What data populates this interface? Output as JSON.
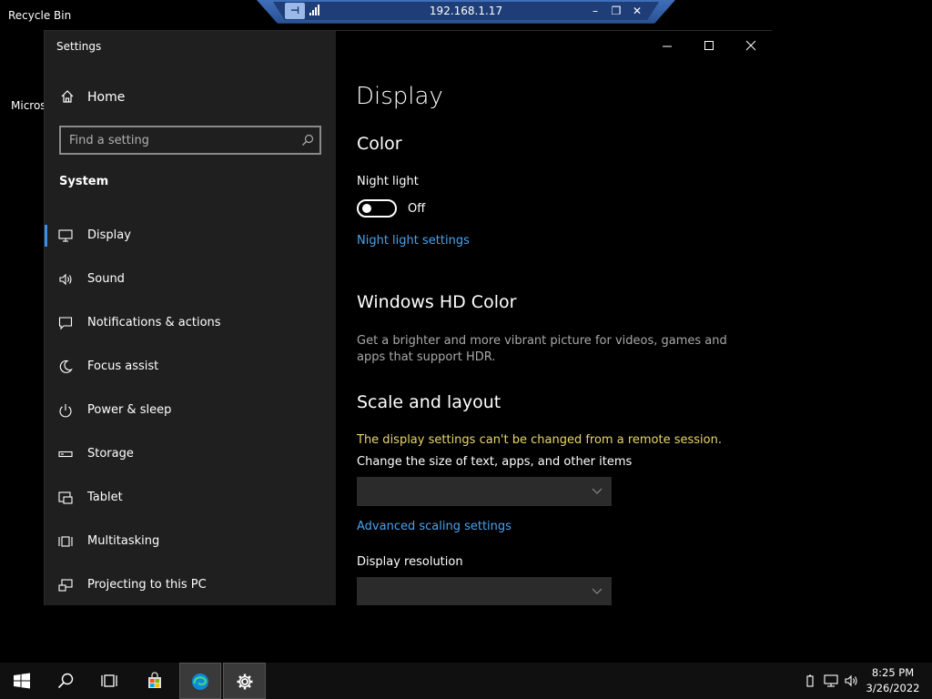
{
  "desktop": {
    "recycle_bin_label": "Recycle Bin",
    "edge_label": "Microsoft Edge"
  },
  "rdp_bar": {
    "host": "192.168.1.17",
    "pin_icon": "pin-icon",
    "signal_icon": "signal-icon"
  },
  "window": {
    "title": "Settings",
    "controls": [
      "minimize",
      "maximize",
      "close"
    ]
  },
  "sidebar": {
    "home_label": "Home",
    "search_placeholder": "Find a setting",
    "section": "System",
    "items": [
      {
        "label": "Display",
        "icon": "monitor-icon",
        "selected": true
      },
      {
        "label": "Sound",
        "icon": "speaker-icon",
        "selected": false
      },
      {
        "label": "Notifications & actions",
        "icon": "notification-icon",
        "selected": false
      },
      {
        "label": "Focus assist",
        "icon": "moon-icon",
        "selected": false
      },
      {
        "label": "Power & sleep",
        "icon": "power-icon",
        "selected": false
      },
      {
        "label": "Storage",
        "icon": "storage-icon",
        "selected": false
      },
      {
        "label": "Tablet",
        "icon": "tablet-icon",
        "selected": false
      },
      {
        "label": "Multitasking",
        "icon": "multitasking-icon",
        "selected": false
      },
      {
        "label": "Projecting to this PC",
        "icon": "projecting-icon",
        "selected": false
      }
    ]
  },
  "main": {
    "page_title": "Display",
    "color_heading": "Color",
    "night_light_label": "Night light",
    "night_light_state": "Off",
    "night_light_on": false,
    "night_light_link": "Night light settings",
    "hd_color_heading": "Windows HD Color",
    "hd_color_desc": "Get a brighter and more vibrant picture for videos, games and apps that support HDR.",
    "scale_heading": "Scale and layout",
    "remote_warning": "The display settings can't be changed from a remote session.",
    "scale_label": "Change the size of text, apps, and other items",
    "scale_value": "",
    "advanced_scaling_link": "Advanced scaling settings",
    "resolution_label": "Display resolution",
    "resolution_value": ""
  },
  "taskbar": {
    "items": [
      "start-icon",
      "search-icon",
      "task-view-icon",
      "store-icon",
      "edge-icon",
      "settings-icon"
    ],
    "active": "settings-icon",
    "time": "8:25 PM",
    "date": "3/26/2022"
  },
  "colors": {
    "accent": "#3a8ee6",
    "link": "#4aa3f0",
    "warning": "#e8d66b",
    "sidebar_bg": "#1f1f1f"
  }
}
